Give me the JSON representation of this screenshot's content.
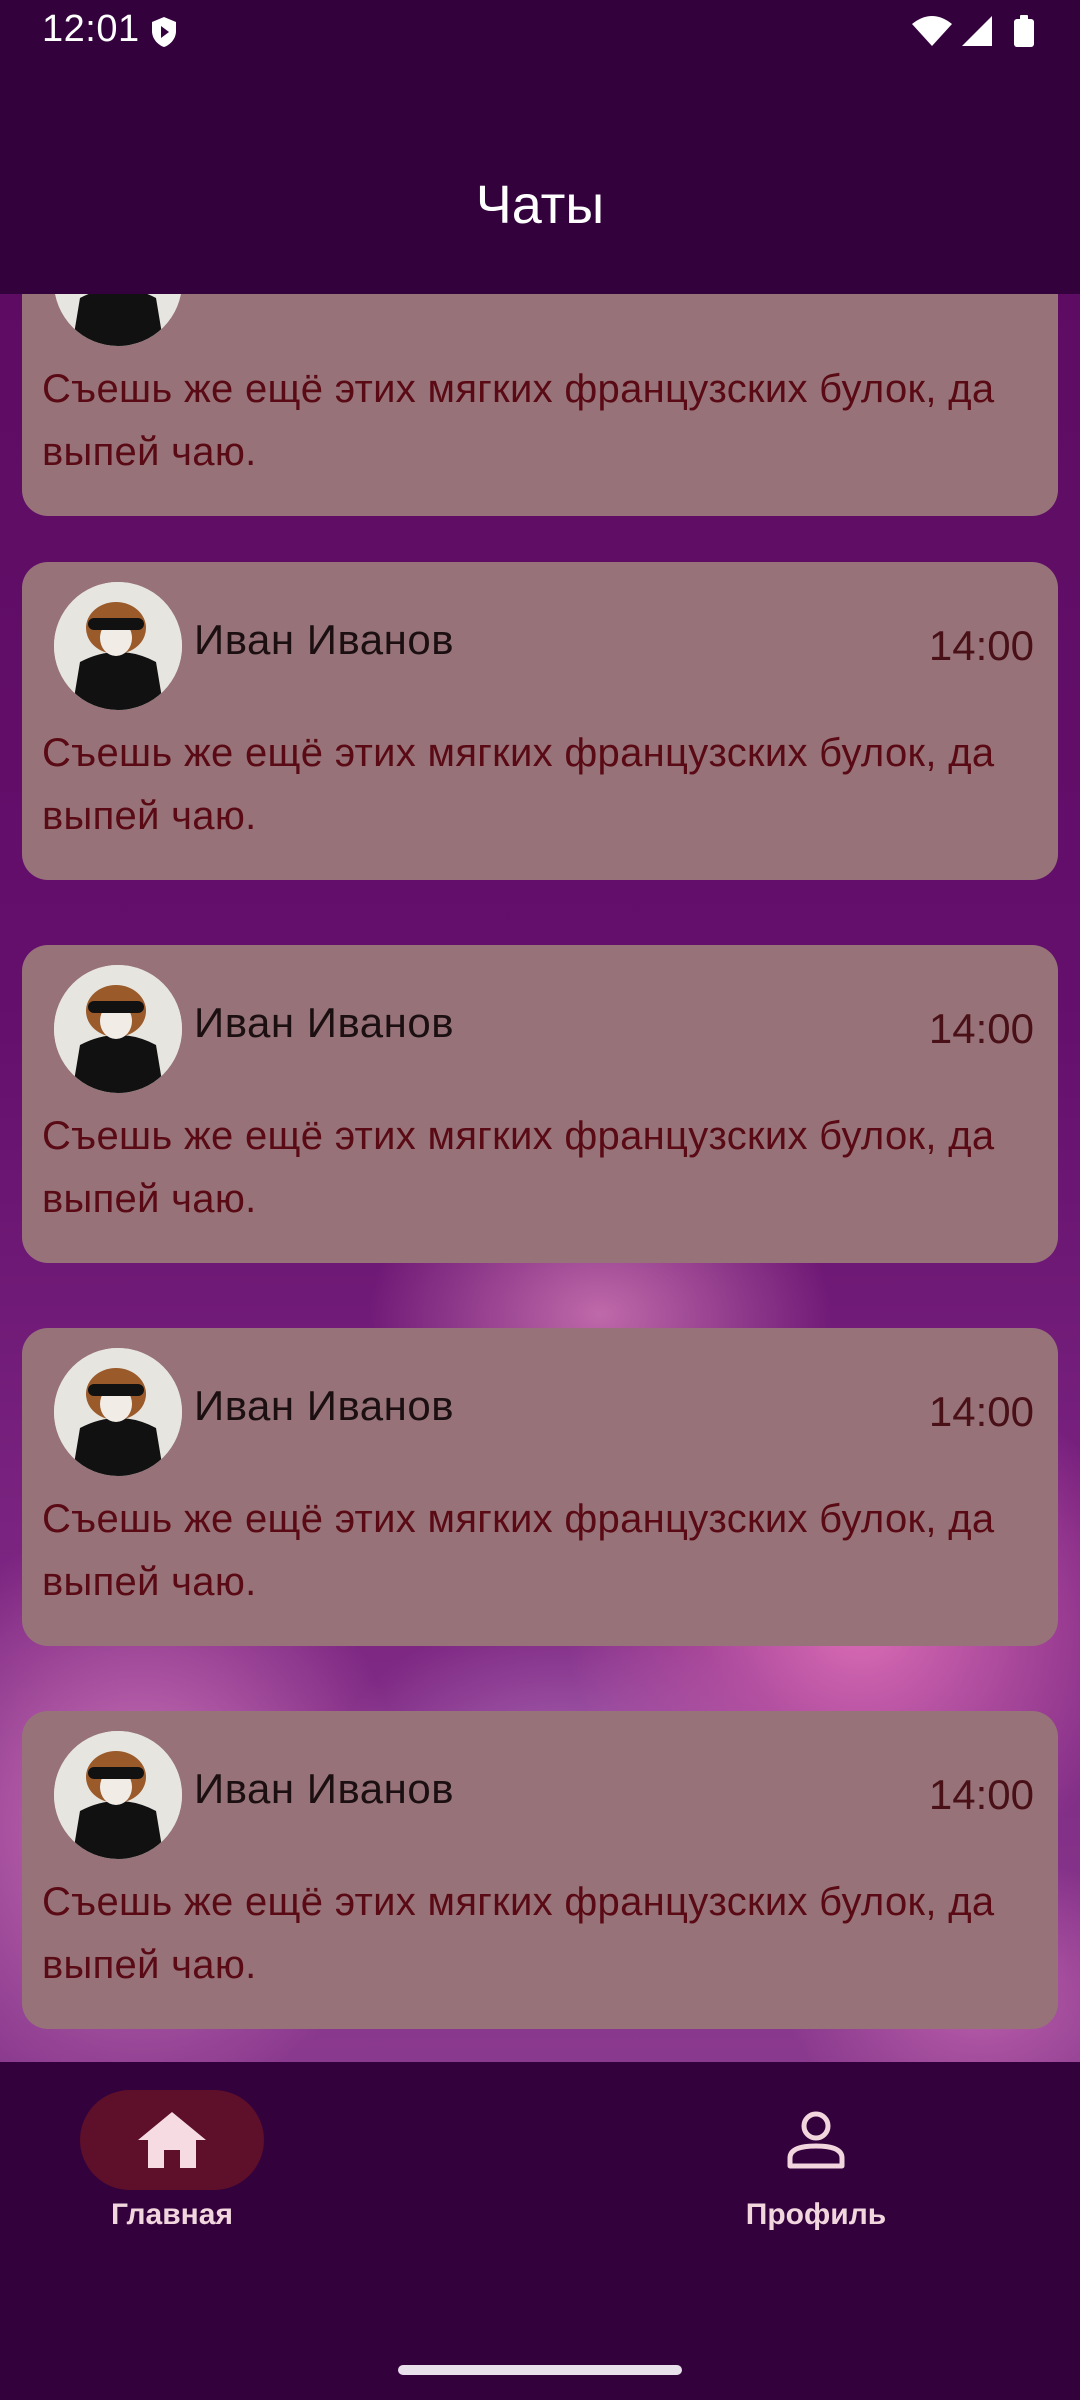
{
  "status_bar": {
    "time": "12:01",
    "icons": [
      "shield-icon",
      "wifi-icon",
      "signal-icon",
      "battery-icon"
    ]
  },
  "app_bar": {
    "title": "Чаты"
  },
  "chats": [
    {
      "name": "",
      "time": "",
      "message": "Съешь же ещё этих мягких французских булок, да выпей чаю."
    },
    {
      "name": "Иван Иванов",
      "time": "14:00",
      "message": "Съешь же ещё этих мягких французских булок, да выпей чаю."
    },
    {
      "name": "Иван Иванов",
      "time": "14:00",
      "message": "Съешь же ещё этих мягких французских булок, да выпей чаю."
    },
    {
      "name": "Иван Иванов",
      "time": "14:00",
      "message": "Съешь же ещё этих мягких французских булок, да выпей чаю."
    },
    {
      "name": "Иван Иванов",
      "time": "14:00",
      "message": "Съешь же ещё этих мягких французских булок, да выпей чаю."
    }
  ],
  "bottom_nav": {
    "items": [
      {
        "label": "Главная",
        "icon": "home-icon",
        "active": true
      },
      {
        "label": "Профиль",
        "icon": "person-icon",
        "active": false
      }
    ]
  },
  "colors": {
    "app_bar_bg": "#33023d",
    "card_bg": "#977379",
    "message_text": "#5a0a14",
    "active_nav_pill": "#5e0f29"
  }
}
